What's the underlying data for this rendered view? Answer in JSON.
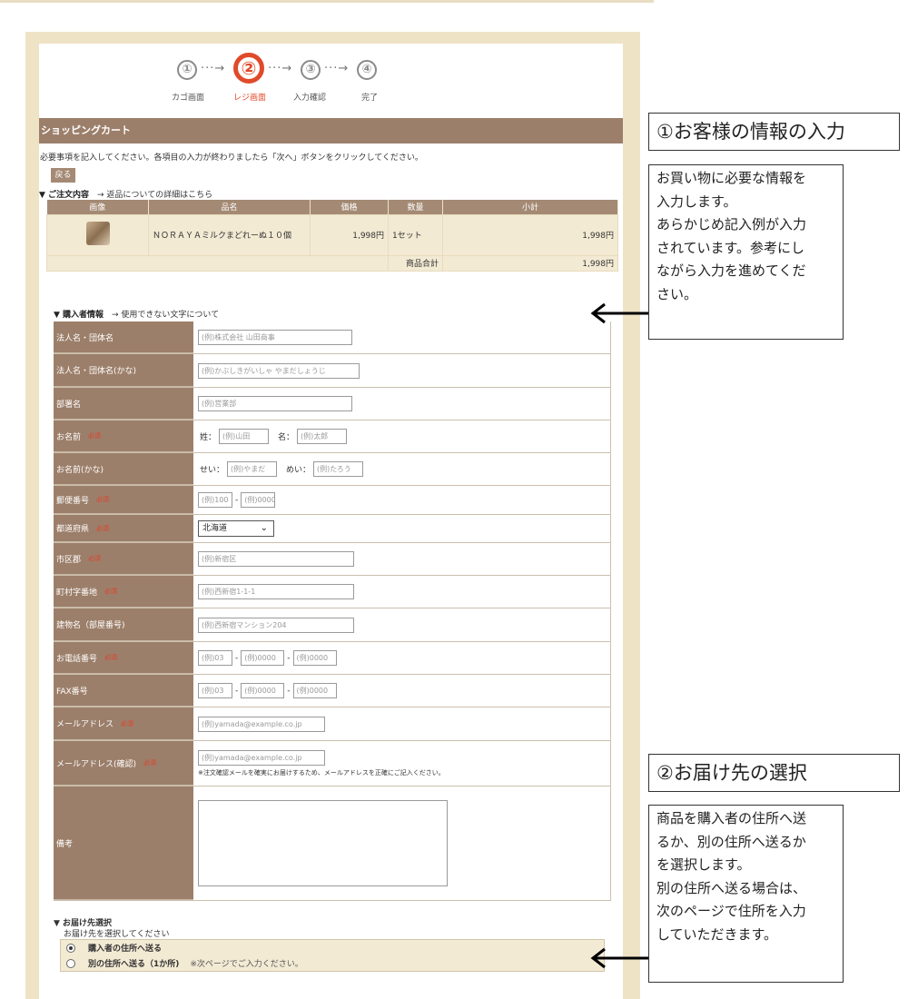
{
  "steps": [
    {
      "num": "①",
      "label": "カゴ画面",
      "active": false
    },
    {
      "num": "②",
      "label": "レジ画面",
      "active": true
    },
    {
      "num": "③",
      "label": "入力確認",
      "active": false
    },
    {
      "num": "④",
      "label": "完了",
      "active": false
    }
  ],
  "step_arrow": "···→",
  "section_title": "ショッピングカート",
  "instruction": "必要事項を記入してください。各項目の入力が終わりましたら「次へ」ボタンをクリックしてください。",
  "back_button": "戻る",
  "order": {
    "heading": "▼ ご注文内容",
    "link": "→ 返品についての詳細はこちら",
    "columns": [
      "画像",
      "品名",
      "価格",
      "数量",
      "小計"
    ],
    "item": {
      "name": "ＮＯＲＡＹＡミルクまどれーぬ１０個",
      "price": "1,998円",
      "qty": "1セット",
      "subtotal": "1,998円"
    },
    "total_label": "商品合計",
    "total_value": "1,998円"
  },
  "buyer": {
    "heading": "▼ 購入者情報",
    "link": "→ 使用できない文字について",
    "required_mark": "必須",
    "company": {
      "label": "法人名・団体名",
      "placeholder": "(例)株式会社 山田商事"
    },
    "company_kana": {
      "label": "法人名・団体名(かな)",
      "placeholder": "(例)かぶしきがいしゃ やまだしょうじ"
    },
    "department": {
      "label": "部署名",
      "placeholder": "(例)営業部"
    },
    "name": {
      "label": "お名前",
      "sei_label": "姓：",
      "sei_placeholder": "(例)山田",
      "mei_label": "名：",
      "mei_placeholder": "(例)太郎"
    },
    "name_kana": {
      "label": "お名前(かな)",
      "sei_label": "せい：",
      "sei_placeholder": "(例)やまだ",
      "mei_label": "めい：",
      "mei_placeholder": "(例)たろう"
    },
    "postal": {
      "label": "郵便番号",
      "p1": "(例)100",
      "sep": "-",
      "p2": "(例)0000"
    },
    "prefecture": {
      "label": "都道府県",
      "value": "北海道"
    },
    "city": {
      "label": "市区郡",
      "placeholder": "(例)新宿区"
    },
    "town": {
      "label": "町村字番地",
      "placeholder": "(例)西新宿1-1-1"
    },
    "building": {
      "label": "建物名（部屋番号)",
      "placeholder": "(例)西新宿マンション204"
    },
    "phone": {
      "label": "お電話番号",
      "p1": "(例)03",
      "p2": "(例)0000",
      "p3": "(例)0000"
    },
    "fax": {
      "label": "FAX番号",
      "p1": "(例)03",
      "p2": "(例)0000",
      "p3": "(例)0000"
    },
    "email": {
      "label": "メールアドレス",
      "placeholder": "(例)yamada@example.co.jp"
    },
    "email_confirm": {
      "label": "メールアドレス(確認)",
      "placeholder": "(例)yamada@example.co.jp",
      "note": "※注文確認メールを確実にお届けするため、メールアドレスを正確にご記入ください。"
    },
    "memo": {
      "label": "備考"
    }
  },
  "delivery": {
    "heading": "▼ お届け先選択",
    "sub": "お届け先を選択してください",
    "options": [
      {
        "label": "購入者の住所へ送る",
        "selected": true,
        "note": ""
      },
      {
        "label": "別の住所へ送る（1か所)",
        "selected": false,
        "note": "※次ページでご入力ください。"
      }
    ]
  },
  "annotations": {
    "first_title": "①お客様の情報の入力",
    "first_body": [
      "お買い物に必要な情報を",
      "入力します。",
      "あらかじめ記入例が入力",
      "されています。参考にし",
      "ながら入力を進めてくだ",
      "さい。"
    ],
    "second_title": "②お届け先の選択",
    "second_body": [
      "商品を購入者の住所へ送",
      "るか、別の住所へ送るか",
      "を選択します。",
      "別の住所へ送る場合は、",
      "次のページで住所を入力",
      "していただきます。"
    ]
  }
}
